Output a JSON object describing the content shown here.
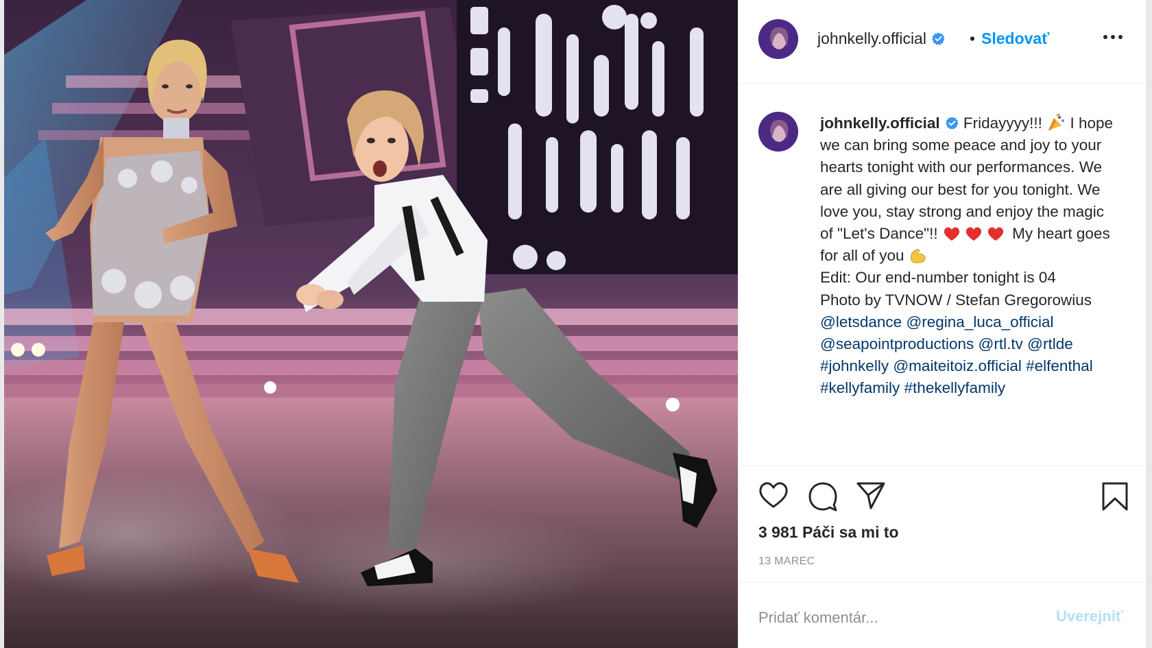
{
  "header": {
    "username": "johnkelly.official",
    "separator": "•",
    "follow_label": "Sledovať",
    "more_icon": "more-horizontal-icon"
  },
  "caption": {
    "username": "johnkelly.official",
    "text_1": "Fridayyyy!!!",
    "text_2": "I hope we can bring some peace and joy to your hearts tonight with our performances. We are all giving our best for you tonight. We love you, stay strong and enjoy the magic of \"Let's Dance\"!!",
    "text_3": "My heart goes for all of you",
    "edit_line": "Edit: Our end-number tonight is 04",
    "photo_credit": "Photo by TVNOW / Stefan Gregorowius",
    "tags": [
      "@letsdance",
      "@regina_luca_official",
      "@seapointproductions",
      "@rtl.tv",
      "@rtlde",
      "#johnkelly",
      "@maiteitoiz.official",
      "#elfenthal",
      "#kellyfamily",
      "#thekellyfamily"
    ]
  },
  "actions": {
    "like_icon": "heart-icon",
    "comment_icon": "comment-icon",
    "share_icon": "paper-plane-icon",
    "save_icon": "bookmark-icon",
    "likes_text": "3 981 Páči sa mi to",
    "date": "13 MAREC"
  },
  "comment": {
    "placeholder": "Pridať komentár...",
    "post_label": "Uverejniť"
  },
  "colors": {
    "link_blue": "#0095f6",
    "tag_blue": "#00376b",
    "post_disabled": "#b2dffc",
    "text": "#262626",
    "muted": "#8e8e8e"
  }
}
